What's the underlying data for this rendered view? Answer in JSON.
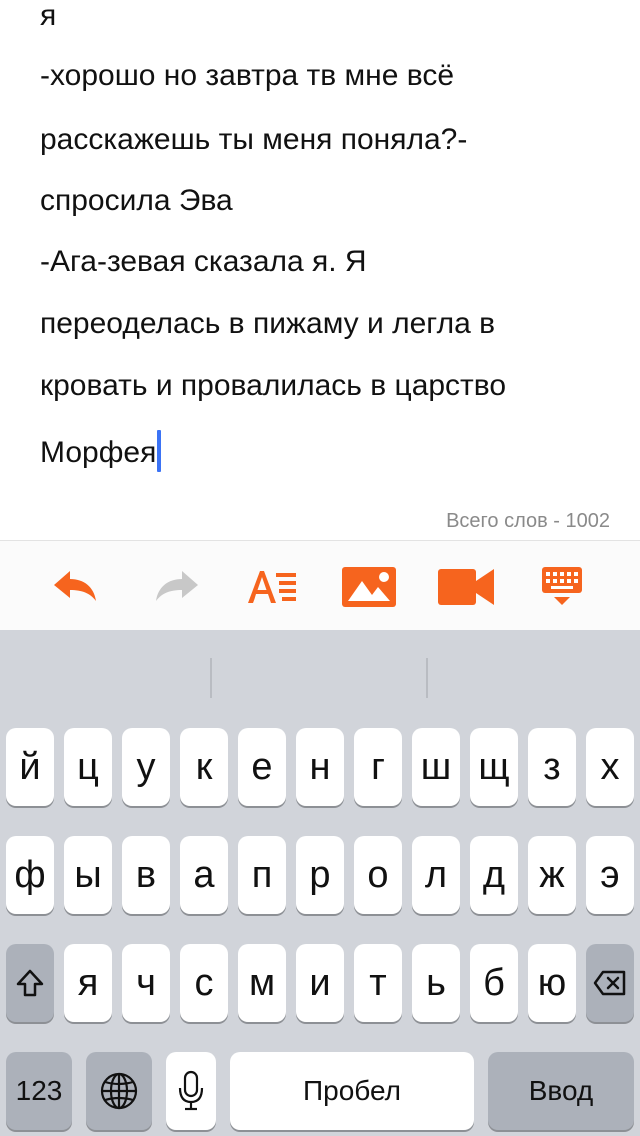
{
  "editor": {
    "lines": [
      "я",
      "-хорошо но завтра тв мне всё",
      "расскажешь ты меня поняла?-",
      "спросила Эва",
      "-Ага-зевая сказала я. Я",
      "переоделась в пижаму и легла в",
      "кровать и провалилась в царство",
      "Морфея"
    ],
    "word_count": "Всего слов - 1002"
  },
  "toolbar": {
    "accent": "#f6641e",
    "disabled": "#c8c8c8",
    "icons": [
      "undo-icon",
      "redo-icon",
      "text-format-icon",
      "image-icon",
      "video-icon",
      "hide-keyboard-icon"
    ]
  },
  "keyboard": {
    "row1": [
      "й",
      "ц",
      "у",
      "к",
      "е",
      "н",
      "г",
      "ш",
      "щ",
      "з",
      "х"
    ],
    "row2": [
      "ф",
      "ы",
      "в",
      "а",
      "п",
      "р",
      "о",
      "л",
      "д",
      "ж",
      "э"
    ],
    "row3": [
      "я",
      "ч",
      "с",
      "м",
      "и",
      "т",
      "ь",
      "б",
      "ю"
    ],
    "numbers_label": "123",
    "space_label": "Пробел",
    "return_label": "Ввод"
  }
}
